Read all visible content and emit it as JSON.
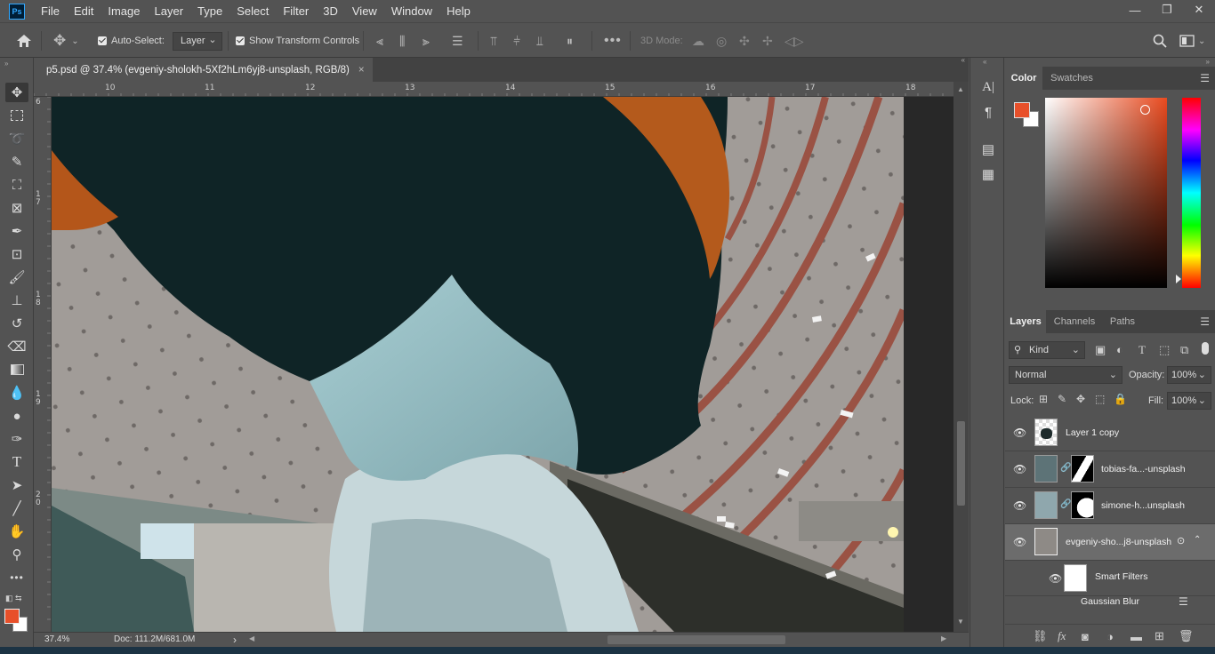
{
  "app": {
    "logo": "Ps"
  },
  "menu": [
    "File",
    "Edit",
    "Image",
    "Layer",
    "Type",
    "Select",
    "Filter",
    "3D",
    "View",
    "Window",
    "Help"
  ],
  "window_controls": [
    "—",
    "❐",
    "✕"
  ],
  "options": {
    "auto_select_label": "Auto-Select:",
    "auto_select_value": "Layer",
    "show_transform_label": "Show Transform Controls",
    "mode_3d_label": "3D Mode:"
  },
  "document": {
    "tab_title": "p5.psd @ 37.4% (evgeniy-sholokh-5Xf2hLm6yj8-unsplash, RGB/8)",
    "close": "×"
  },
  "ruler": {
    "top_labels": [
      "10",
      "11",
      "12",
      "13",
      "14",
      "15",
      "16",
      "17",
      "18"
    ],
    "left_labels": [
      "6",
      "1 7",
      "1 8",
      "1 9",
      "2 0"
    ]
  },
  "status": {
    "zoom": "37.4%",
    "doc": "Doc: 111.2M/681.0M",
    "arrow": "›"
  },
  "color_panel": {
    "tabs": [
      "Color",
      "Swatches"
    ],
    "foreground": "#e8502a",
    "background": "#ffffff"
  },
  "layers_panel": {
    "tabs": [
      "Layers",
      "Channels",
      "Paths"
    ],
    "kind_label": "Kind",
    "blend_mode": "Normal",
    "opacity_label": "Opacity:",
    "opacity_value": "100%",
    "lock_label": "Lock:",
    "fill_label": "Fill:",
    "fill_value": "100%",
    "layers": [
      {
        "name": "Layer 1 copy",
        "has_mask": false
      },
      {
        "name": "tobias-fa...-unsplash",
        "has_mask": true
      },
      {
        "name": "simone-h...unsplash",
        "has_mask": true
      },
      {
        "name": "evgeniy-sho...j8-unsplash",
        "has_mask": false,
        "selected": true
      }
    ],
    "smart_filters_label": "Smart Filters",
    "filter_name": "Gaussian Blur"
  }
}
